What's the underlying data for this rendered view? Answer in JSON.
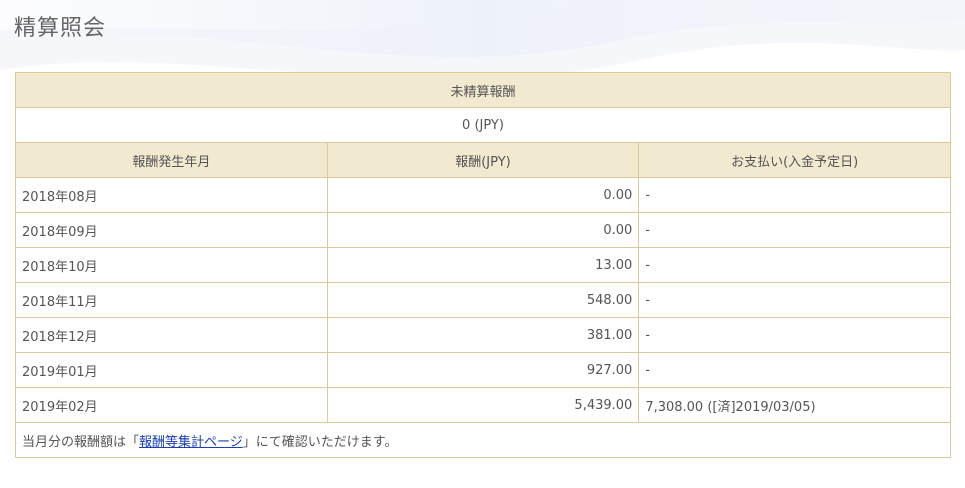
{
  "page": {
    "title": "精算照会"
  },
  "unsettled": {
    "label": "未精算報酬",
    "value": "0 (JPY)"
  },
  "table": {
    "columns": [
      "報酬発生年月",
      "報酬(JPY)",
      "お支払い(入金予定日)"
    ],
    "rows": [
      {
        "month": "2018年08月",
        "amount": "0.00",
        "payment": "-"
      },
      {
        "month": "2018年09月",
        "amount": "0.00",
        "payment": "-"
      },
      {
        "month": "2018年10月",
        "amount": "13.00",
        "payment": "-"
      },
      {
        "month": "2018年11月",
        "amount": "548.00",
        "payment": "-"
      },
      {
        "month": "2018年12月",
        "amount": "381.00",
        "payment": "-"
      },
      {
        "month": "2019年01月",
        "amount": "927.00",
        "payment": "-"
      },
      {
        "month": "2019年02月",
        "amount": "5,439.00",
        "payment": "7,308.00 ([済]2019/03/05)"
      }
    ]
  },
  "note": {
    "prefix": "当月分の報酬額は「",
    "link_text": "報酬等集計ページ",
    "suffix": "」にて確認いただけます。"
  },
  "colors": {
    "header_bg": "#f2e9d1",
    "border": "#dccb9a",
    "link": "#1a3fb0"
  }
}
